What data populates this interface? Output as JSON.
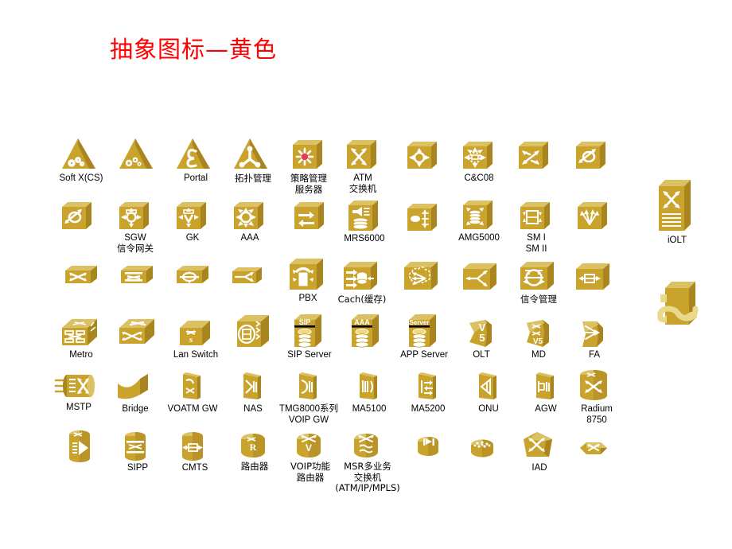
{
  "slide": {
    "title": "抽象图标—黄色",
    "title_color": "#FF0000",
    "background": "#FFFFFF"
  },
  "palette": {
    "icon_face": "#C9A32C",
    "icon_top": "#DCC163",
    "icon_side": "#A98520",
    "icon_mark": "#FFFFFF",
    "accent_red": "#E8385A",
    "label_color": "#000000"
  },
  "rows": [
    {
      "row": 1,
      "items": [
        {
          "name": "soft-x-cs",
          "label": "Soft X(CS)",
          "shape": "triangle",
          "mark": "gears"
        },
        {
          "name": "soft-x-cs-alt",
          "label": "",
          "shape": "triangle",
          "mark": "gears"
        },
        {
          "name": "portal",
          "label": "Portal",
          "shape": "triangle",
          "mark": "epsilon"
        },
        {
          "name": "topology-mgmt",
          "label": "拓扑管理",
          "shape": "triangle",
          "mark": "tri-node"
        },
        {
          "name": "policy-server",
          "label": "策略管理\n服务器",
          "shape": "cube",
          "mark": "starburst-red"
        },
        {
          "name": "atm-switch",
          "label": "ATM\n交换机",
          "shape": "cube",
          "mark": "x-arrows"
        },
        {
          "name": "switch-ring",
          "label": "",
          "shape": "cube",
          "mark": "ring-arrows"
        },
        {
          "name": "cc08",
          "label": "C&C08",
          "shape": "cube",
          "mark": "ring-dashed-arrows"
        },
        {
          "name": "cross-connect",
          "label": "",
          "shape": "cube",
          "mark": "curve-arrows"
        },
        {
          "name": "loop-node",
          "label": "",
          "shape": "cube",
          "mark": "loop-arrow"
        }
      ]
    },
    {
      "row": 2,
      "items": [
        {
          "name": "loop-node-2",
          "label": "",
          "shape": "cube",
          "mark": "loop-arrow"
        },
        {
          "name": "sgw",
          "label": "SGW\n信令网关",
          "shape": "cube",
          "mark": "ring-4arrows"
        },
        {
          "name": "gk",
          "label": "GK",
          "shape": "cube",
          "mark": "v-4arrows"
        },
        {
          "name": "aaa",
          "label": "AAA",
          "shape": "cube",
          "mark": "gear-arrows"
        },
        {
          "name": "double-arrow",
          "label": "",
          "shape": "cube",
          "mark": "two-arrows"
        },
        {
          "name": "mrs6000",
          "label": "MRS6000",
          "shape": "cube",
          "mark": "speaker-disc"
        },
        {
          "name": "oval-lines",
          "label": "",
          "shape": "cube",
          "mark": "oval-bars"
        },
        {
          "name": "amg5000",
          "label": "AMG5000",
          "shape": "cube",
          "mark": "disc-arrows"
        },
        {
          "name": "sm1-sm2",
          "label": "SM I\nSM II",
          "shape": "cube",
          "mark": "panel-arrows"
        },
        {
          "name": "fan-out",
          "label": "",
          "shape": "cube",
          "mark": "fan-arrows"
        }
      ]
    },
    {
      "row": 3,
      "items": [
        {
          "name": "switch-flat-1",
          "label": "",
          "shape": "slab",
          "mark": "x-cross"
        },
        {
          "name": "switch-flat-2",
          "label": "",
          "shape": "slab",
          "mark": "x-bars"
        },
        {
          "name": "switch-flat-3",
          "label": "",
          "shape": "slab",
          "mark": "ring-bar"
        },
        {
          "name": "switch-flat-4",
          "label": "",
          "shape": "slab",
          "mark": "split-arrow"
        },
        {
          "name": "pbx",
          "label": "PBX",
          "shape": "cube",
          "mark": "pbx-handset"
        },
        {
          "name": "cache",
          "label": "Cach(缓存)",
          "shape": "cube",
          "mark": "cache-cyl"
        },
        {
          "name": "cloud-node",
          "label": "",
          "shape": "cube",
          "mark": "cloud-arrows"
        },
        {
          "name": "splitter",
          "label": "",
          "shape": "cube",
          "mark": "split-3"
        },
        {
          "name": "signal-mgmt",
          "label": "信令管理",
          "shape": "cube",
          "mark": "circle-brackets"
        },
        {
          "name": "bidir-panel",
          "label": "",
          "shape": "cube",
          "mark": "bidir-panel"
        }
      ]
    },
    {
      "row": 4,
      "items": [
        {
          "name": "metro",
          "label": "Metro",
          "shape": "box3d",
          "mark": "metro-grid"
        },
        {
          "name": "switch-3d",
          "label": "",
          "shape": "box3d",
          "mark": "x-arrows-flat"
        },
        {
          "name": "lan-switch",
          "label": "Lan Switch",
          "shape": "box3d",
          "mark": "s-switch"
        },
        {
          "name": "tower-unit",
          "label": "",
          "shape": "tower",
          "mark": "oval-rack"
        },
        {
          "name": "sip-server",
          "label": "SIP Server",
          "shape": "tower",
          "mark": "sip-disc",
          "badge": "SIP"
        },
        {
          "name": "aaa-server",
          "label": "",
          "shape": "tower",
          "mark": "aaa-disc",
          "badge": "AAA"
        },
        {
          "name": "app-server",
          "label": "APP Server",
          "shape": "tower",
          "mark": "server-disc",
          "badge": "Server"
        },
        {
          "name": "olt",
          "label": "OLT",
          "shape": "shield",
          "mark": "v5"
        },
        {
          "name": "md",
          "label": "MD",
          "shape": "shield",
          "mark": "xx-v5"
        },
        {
          "name": "fa",
          "label": "FA",
          "shape": "shield",
          "mark": "converge"
        }
      ]
    },
    {
      "row": 5,
      "items": [
        {
          "name": "mstp",
          "label": "MSTP",
          "shape": "cyl-h",
          "mark": "mstp-pins"
        },
        {
          "name": "bridge",
          "label": "Bridge",
          "shape": "bridge",
          "mark": "none"
        },
        {
          "name": "voatm-gw",
          "label": "VOATM GW",
          "shape": "plate",
          "mark": "phone-x"
        },
        {
          "name": "nas",
          "label": "NAS",
          "shape": "plate",
          "mark": "bars-arrow"
        },
        {
          "name": "tmg8000",
          "label": "TMG8000系列\nVOIP GW",
          "shape": "plate",
          "mark": "bars-arrow2"
        },
        {
          "name": "ma5100",
          "label": "MA5100",
          "shape": "plate",
          "mark": "bars-3"
        },
        {
          "name": "ma5200",
          "label": "MA5200",
          "shape": "plate",
          "mark": "arrows-bars"
        },
        {
          "name": "onu",
          "label": "ONU",
          "shape": "plate",
          "mark": "triangle-bars"
        },
        {
          "name": "agw",
          "label": "AGW",
          "shape": "plate",
          "mark": "agw-mark"
        },
        {
          "name": "radium-8750",
          "label": "Radium\n8750",
          "shape": "cyl-v",
          "mark": "x-arrows-big"
        }
      ]
    },
    {
      "row": 6,
      "items": [
        {
          "name": "media-cyl",
          "label": "",
          "shape": "cyl-v",
          "mark": "play-bars"
        },
        {
          "name": "sipp",
          "label": "SIPP",
          "shape": "cyl-v",
          "mark": "stack-x"
        },
        {
          "name": "cmts",
          "label": "CMTS",
          "shape": "cyl-v",
          "mark": "bidir-box"
        },
        {
          "name": "router",
          "label": "路由器",
          "shape": "cyl-s",
          "mark": "router-R"
        },
        {
          "name": "voip-router",
          "label": "VOIP功能\n路由器",
          "shape": "cyl-s",
          "mark": "router-V"
        },
        {
          "name": "msr-switch",
          "label": "MSR多业务\n交换机\n(ATM/IP/MPLS)",
          "shape": "cyl-s",
          "mark": "router-DC"
        },
        {
          "name": "play-cyl",
          "label": "",
          "shape": "cyl-s",
          "mark": "play-flag"
        },
        {
          "name": "dots-cyl",
          "label": "",
          "shape": "cyl-s",
          "mark": "dots"
        },
        {
          "name": "iad",
          "label": "IAD",
          "shape": "pent",
          "mark": "x-arrows-pent"
        },
        {
          "name": "hex-switch",
          "label": "",
          "shape": "hex",
          "mark": "x-small"
        }
      ]
    }
  ],
  "side_items": [
    {
      "name": "iolt",
      "label": "iOLT",
      "shape": "rack",
      "mark": "x-arrows-rack"
    },
    {
      "name": "wrapped-box",
      "label": "",
      "shape": "wrapped",
      "mark": "ribbon-arrows"
    }
  ]
}
